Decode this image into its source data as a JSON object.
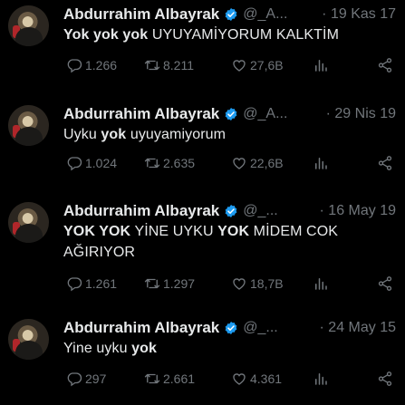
{
  "tweets": [
    {
      "name": "Abdurrahim Albayrak",
      "handle": "@_A...",
      "date": "· 19 Kas 17",
      "text_segments": [
        {
          "t": "Yok yok yok",
          "bold": true
        },
        {
          "t": " UYUYAMİYORUM KALKTİM",
          "bold": false
        }
      ],
      "replies": "1.266",
      "retweets": "8.211",
      "likes": "27,6B"
    },
    {
      "name": "Abdurrahim Albayrak",
      "handle": "@_A...",
      "date": "· 29 Nis 19",
      "text_segments": [
        {
          "t": "Uyku ",
          "bold": false
        },
        {
          "t": "yok",
          "bold": true
        },
        {
          "t": " uyuyamiyorum",
          "bold": false
        }
      ],
      "replies": "1.024",
      "retweets": "2.635",
      "likes": "22,6B"
    },
    {
      "name": "Abdurrahim Albayrak",
      "handle": "@_...",
      "date": "· 16 May 19",
      "text_segments": [
        {
          "t": "YOK YOK",
          "bold": true
        },
        {
          "t": " YİNE UYKU ",
          "bold": false
        },
        {
          "t": "YOK",
          "bold": true
        },
        {
          "t": " MİDEM COK AĞIRIYOR",
          "bold": false
        }
      ],
      "replies": "1.261",
      "retweets": "1.297",
      "likes": "18,7B"
    },
    {
      "name": "Abdurrahim Albayrak",
      "handle": "@_...",
      "date": "· 24 May 15",
      "text_segments": [
        {
          "t": "Yine uyku ",
          "bold": false
        },
        {
          "t": "yok",
          "bold": true
        }
      ],
      "replies": "297",
      "retweets": "2.661",
      "likes": "4.361"
    }
  ],
  "icons": {
    "reply": "reply-icon",
    "retweet": "retweet-icon",
    "like": "heart-icon",
    "views": "views-icon",
    "share": "share-icon",
    "verified": "verified-badge-icon"
  },
  "colors": {
    "background": "#000000",
    "text": "#e7e9ea",
    "muted": "#71767b",
    "verified": "#1d9bf0"
  }
}
